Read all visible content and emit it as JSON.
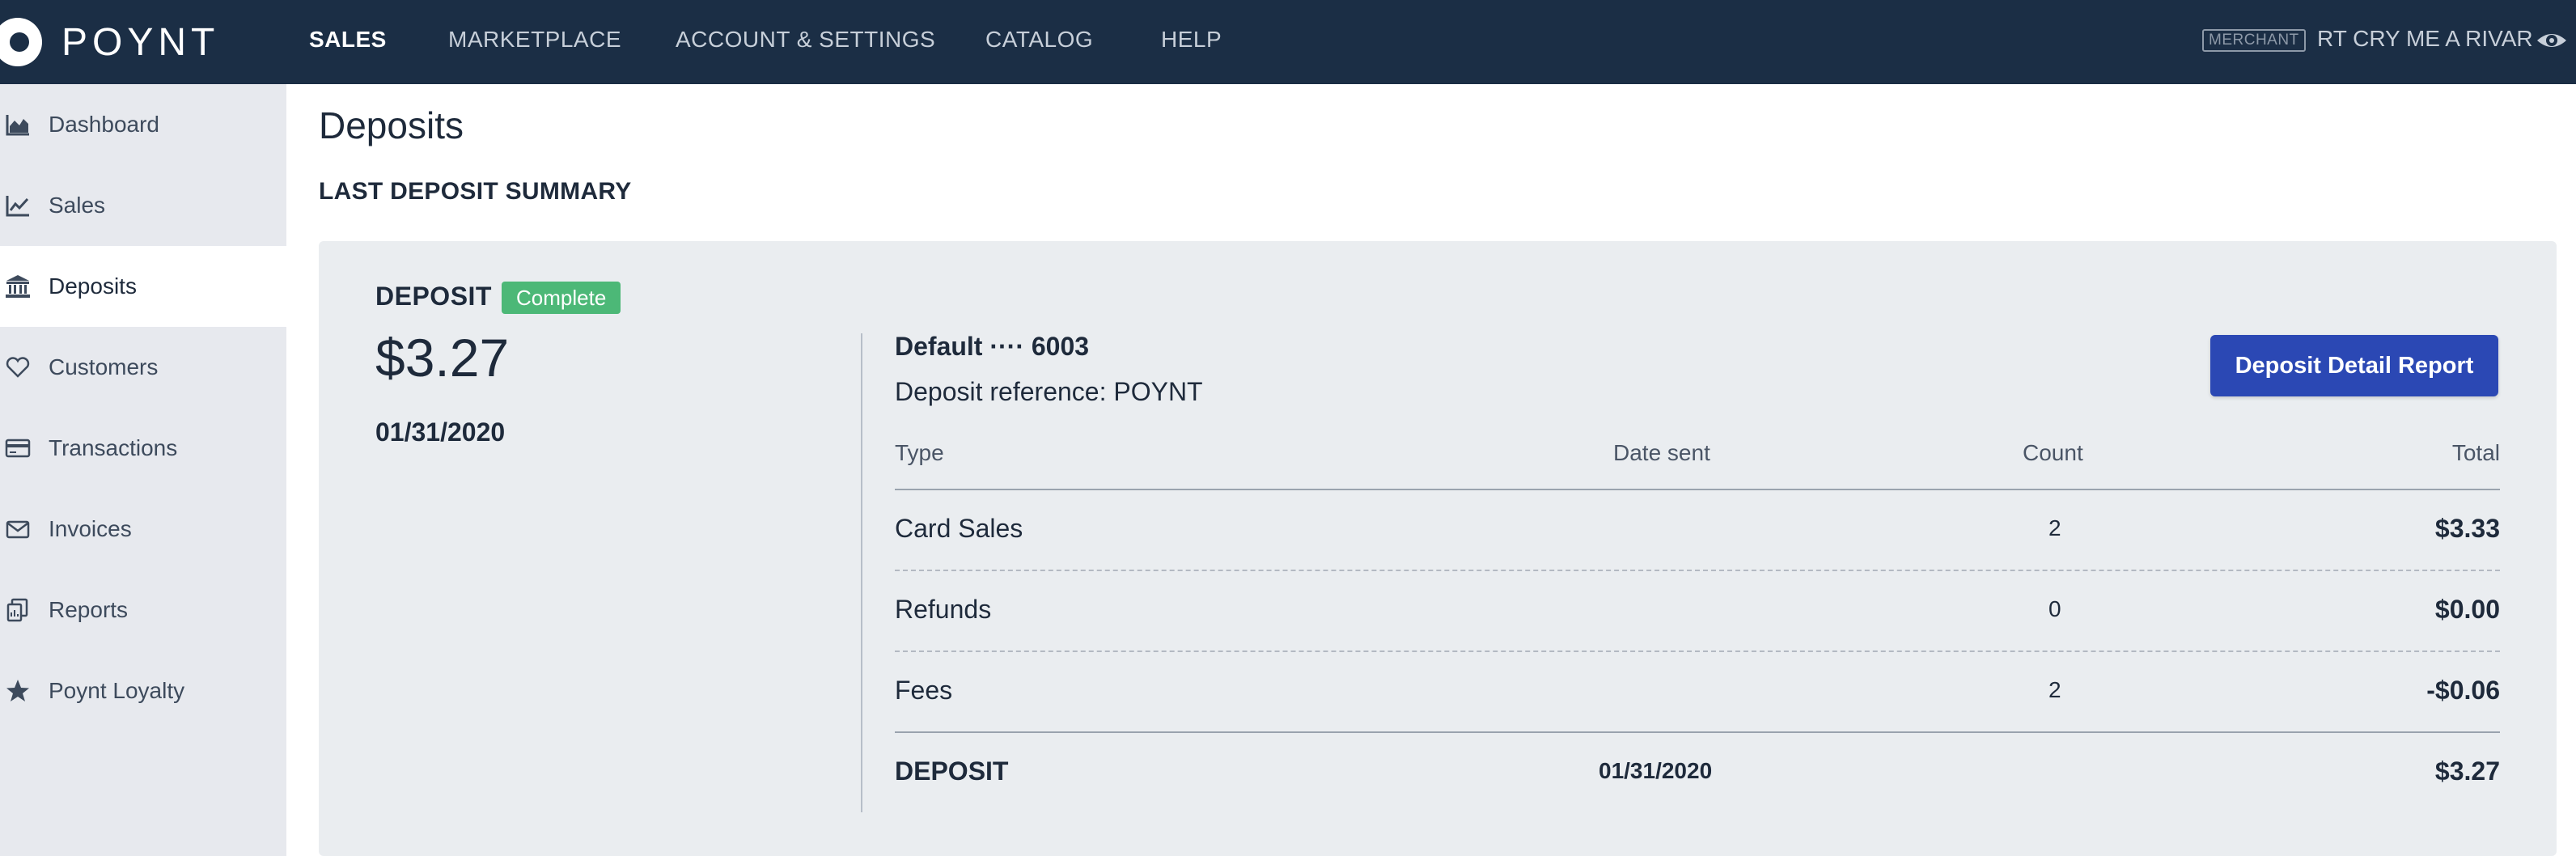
{
  "topbar": {
    "logo_text": "POYNT",
    "nav": [
      {
        "label": "SALES",
        "active": true
      },
      {
        "label": "MARKETPLACE",
        "active": false
      },
      {
        "label": "ACCOUNT & SETTINGS",
        "active": false
      },
      {
        "label": "CATALOG",
        "active": false
      },
      {
        "label": "HELP",
        "active": false
      }
    ],
    "merchant_badge": "MERCHANT",
    "merchant_name": "RT CRY ME A RIVAR",
    "bg_color": "#1b2e45"
  },
  "sidebar": {
    "items": [
      {
        "label": "Dashboard",
        "icon": "area-chart-icon",
        "active": false
      },
      {
        "label": "Sales",
        "icon": "line-chart-icon",
        "active": false
      },
      {
        "label": "Deposits",
        "icon": "bank-icon",
        "active": true
      },
      {
        "label": "Customers",
        "icon": "heart-icon",
        "active": false
      },
      {
        "label": "Transactions",
        "icon": "credit-card-icon",
        "active": false
      },
      {
        "label": "Invoices",
        "icon": "envelope-icon",
        "active": false
      },
      {
        "label": "Reports",
        "icon": "reports-icon",
        "active": false
      },
      {
        "label": "Poynt Loyalty",
        "icon": "star-icon",
        "active": false
      }
    ]
  },
  "main": {
    "page_title": "Deposits",
    "section_title": "LAST DEPOSIT SUMMARY",
    "deposit": {
      "label": "DEPOSIT",
      "status": "Complete",
      "status_color": "#4cb877",
      "amount": "$3.27",
      "date": "01/31/2020",
      "account": "Default ···· 6003",
      "reference": "Deposit reference: POYNT",
      "detail_button": "Deposit Detail Report",
      "button_color": "#2b48b4"
    },
    "table": {
      "headers": {
        "type": "Type",
        "date_sent": "Date sent",
        "count": "Count",
        "total": "Total"
      },
      "rows": [
        {
          "type": "Card Sales",
          "date_sent": "",
          "count": "2",
          "total": "$3.33"
        },
        {
          "type": "Refunds",
          "date_sent": "",
          "count": "0",
          "total": "$0.00"
        },
        {
          "type": "Fees",
          "date_sent": "",
          "count": "2",
          "total": "-$0.06"
        }
      ],
      "summary": {
        "type": "DEPOSIT",
        "date_sent": "01/31/2020",
        "count": "",
        "total": "$3.27"
      }
    }
  }
}
